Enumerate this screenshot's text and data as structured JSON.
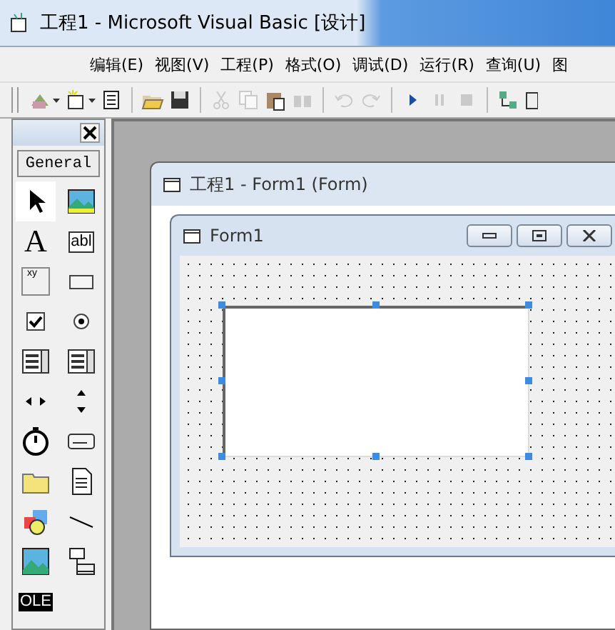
{
  "window": {
    "title": "工程1 - Microsoft Visual Basic [设计]"
  },
  "menu": [
    {
      "label": "编辑(E)"
    },
    {
      "label": "视图(V)"
    },
    {
      "label": "工程(P)"
    },
    {
      "label": "格式(O)"
    },
    {
      "label": "调试(D)"
    },
    {
      "label": "运行(R)"
    },
    {
      "label": "查询(U)"
    },
    {
      "label": "图"
    }
  ],
  "toolbar": [
    {
      "kind": "addproject",
      "dropdown": true,
      "disabled": false
    },
    {
      "kind": "addform",
      "dropdown": true,
      "disabled": false
    },
    {
      "kind": "menueditor",
      "dropdown": false,
      "disabled": false
    },
    {
      "kind": "separator"
    },
    {
      "kind": "open",
      "dropdown": false,
      "disabled": false
    },
    {
      "kind": "save",
      "dropdown": false,
      "disabled": false
    },
    {
      "kind": "separator"
    },
    {
      "kind": "cut",
      "dropdown": false,
      "disabled": true
    },
    {
      "kind": "copy",
      "dropdown": false,
      "disabled": true
    },
    {
      "kind": "paste",
      "dropdown": false,
      "disabled": false
    },
    {
      "kind": "find",
      "dropdown": false,
      "disabled": true
    },
    {
      "kind": "separator"
    },
    {
      "kind": "undo",
      "dropdown": false,
      "disabled": true
    },
    {
      "kind": "redo",
      "dropdown": false,
      "disabled": true
    },
    {
      "kind": "separator"
    },
    {
      "kind": "run",
      "dropdown": false,
      "disabled": false
    },
    {
      "kind": "pause",
      "dropdown": false,
      "disabled": true
    },
    {
      "kind": "stop",
      "dropdown": false,
      "disabled": true
    },
    {
      "kind": "separator"
    },
    {
      "kind": "explorer",
      "dropdown": false,
      "disabled": false
    },
    {
      "kind": "properties",
      "dropdown": false,
      "disabled": false
    }
  ],
  "toolbox": {
    "tab": "General",
    "items": [
      {
        "kind": "pointer",
        "selected": true
      },
      {
        "kind": "picture",
        "selected": false
      },
      {
        "kind": "label",
        "glyph": "A",
        "selected": false
      },
      {
        "kind": "textbox",
        "glyph": "abl",
        "selected": false
      },
      {
        "kind": "frame",
        "glyph": "xy",
        "selected": false
      },
      {
        "kind": "button",
        "selected": false
      },
      {
        "kind": "checkbox",
        "selected": false
      },
      {
        "kind": "option",
        "selected": false
      },
      {
        "kind": "combo",
        "selected": false
      },
      {
        "kind": "list",
        "selected": false
      },
      {
        "kind": "hscroll",
        "selected": false
      },
      {
        "kind": "vscroll",
        "selected": false
      },
      {
        "kind": "timer",
        "selected": false
      },
      {
        "kind": "drive",
        "selected": false
      },
      {
        "kind": "dir",
        "selected": false
      },
      {
        "kind": "file",
        "selected": false
      },
      {
        "kind": "shape",
        "selected": false
      },
      {
        "kind": "line",
        "selected": false
      },
      {
        "kind": "image",
        "selected": false
      },
      {
        "kind": "data",
        "selected": false
      },
      {
        "kind": "ole",
        "glyph": "OLE",
        "selected": false
      }
    ]
  },
  "designer": {
    "title": "工程1 - Form1 (Form)",
    "form": {
      "title": "Form1",
      "control": {
        "selected": true
      }
    }
  }
}
